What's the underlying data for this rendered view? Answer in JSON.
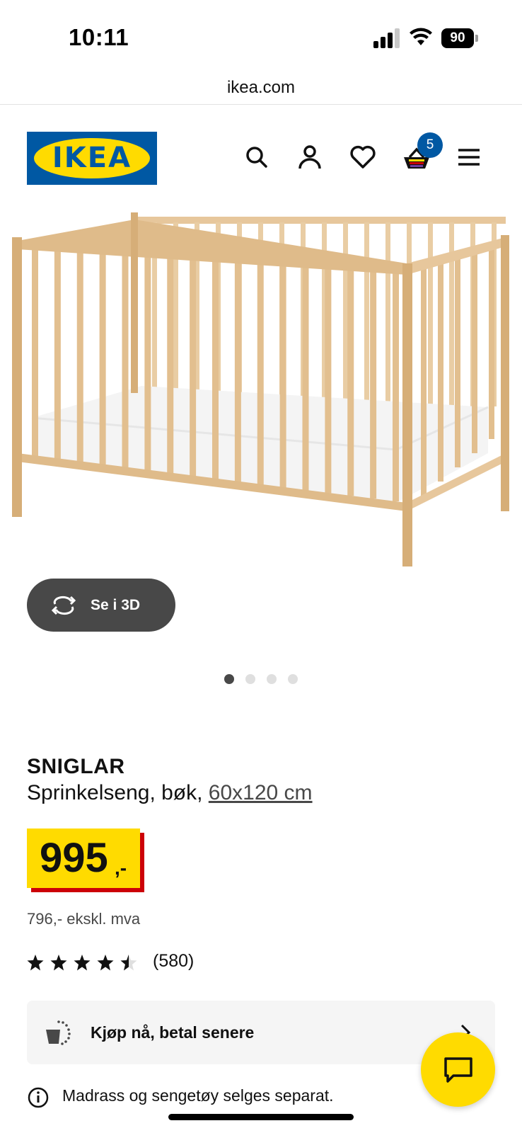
{
  "status_bar": {
    "time": "10:11",
    "battery": "90"
  },
  "browser": {
    "url": "ikea.com"
  },
  "header": {
    "logo_text": "IKEA",
    "cart_count": "5",
    "icons": [
      "search-icon",
      "account-icon",
      "heart-icon",
      "cart-icon",
      "menu-icon"
    ]
  },
  "gallery": {
    "view_3d_label": "Se i 3D",
    "slide_count": 4,
    "active_slide": 1
  },
  "product": {
    "name": "SNIGLAR",
    "description": "Sprinkelseng, bøk,",
    "size": "60x120 cm",
    "price": "995",
    "price_suffix": ",-",
    "price_ex_vat": "796,- ekskl. mva",
    "rating": 4.5,
    "rating_count": "(580)"
  },
  "pay_later": {
    "label": "Kjøp nå, betal senere"
  },
  "info": {
    "text": "Madrass og sengetøy selges separat."
  },
  "colors": {
    "ikea_blue": "#0058a3",
    "ikea_yellow": "#ffdb00",
    "price_red": "#cc0008",
    "dark_gray": "#484848"
  }
}
